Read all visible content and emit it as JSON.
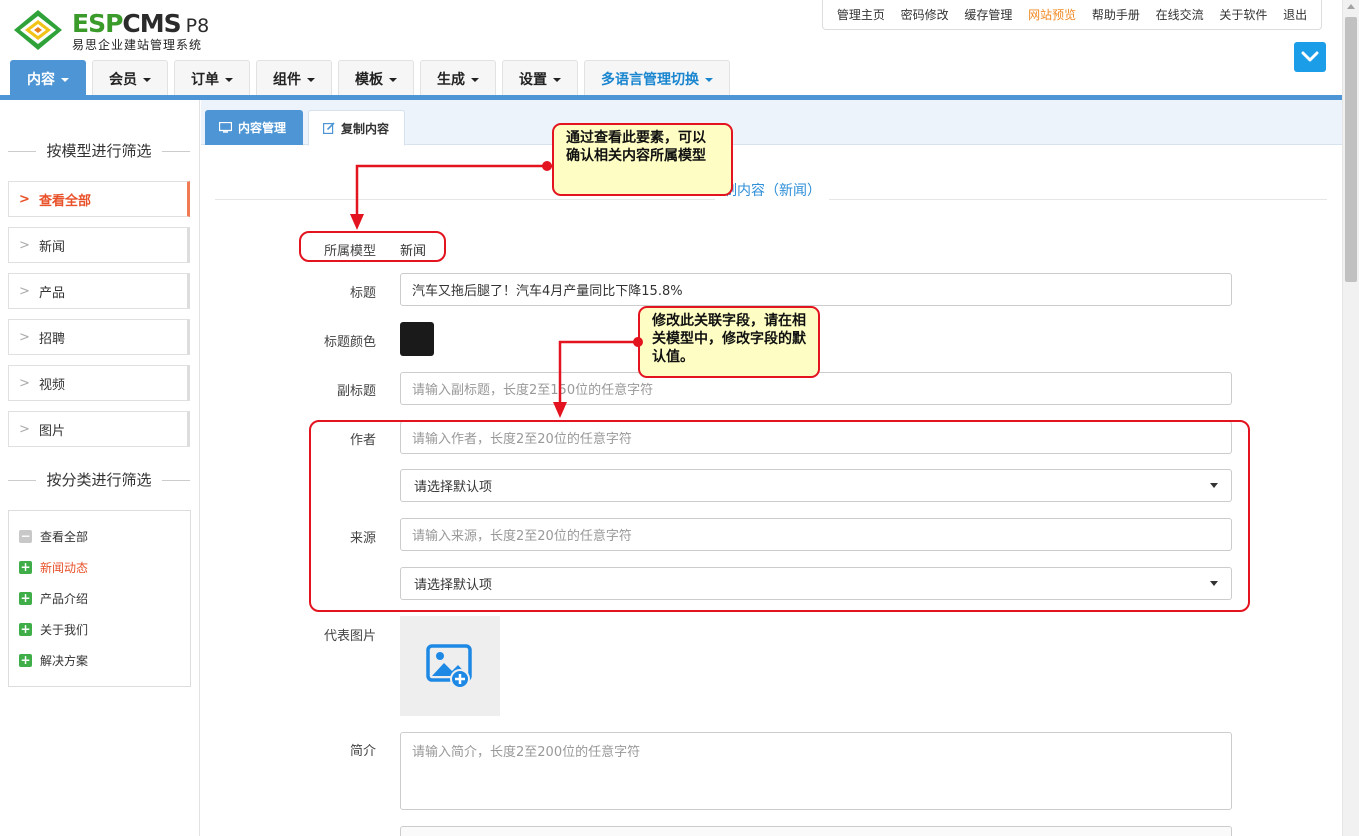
{
  "brand": {
    "esp": "ESP",
    "cms": "CMS",
    "version": "P8",
    "subtitle": "易思企业建站管理系统"
  },
  "topbar": {
    "links": [
      "管理主页",
      "密码修改",
      "缓存管理",
      "网站预览",
      "帮助手册",
      "在线交流",
      "关于软件",
      "退出"
    ],
    "highlight_color": "#f08a24"
  },
  "mainnav": {
    "items": [
      "内容",
      "会员",
      "订单",
      "组件",
      "模板",
      "生成",
      "设置",
      "多语言管理切换"
    ],
    "active_color": "#4d95d4"
  },
  "sidebar": {
    "model_filter_title": "按模型进行筛选",
    "models": [
      "查看全部",
      "新闻",
      "产品",
      "招聘",
      "视频",
      "图片"
    ],
    "category_filter_title": "按分类进行筛选",
    "categories": [
      "查看全部",
      "新闻动态",
      "产品介绍",
      "关于我们",
      "解决方案"
    ]
  },
  "tabs": {
    "content_manage": "内容管理",
    "copy_content": "复制内容"
  },
  "form": {
    "heading_fragment": "制内容（新闻）",
    "model_label": "所属模型",
    "model_value": "新闻",
    "title_label": "标题",
    "title_value": "汽车又拖后腿了！汽车4月产量同比下降15.8%",
    "title_color_label": "标题颜色",
    "title_color_value": "#1a1a1a",
    "subtitle_label": "副标题",
    "subtitle_placeholder": "请输入副标题，长度2至150位的任意字符",
    "author_label": "作者",
    "author_placeholder": "请输入作者，长度2至20位的任意字符",
    "author_select": "请选择默认项",
    "source_label": "来源",
    "source_placeholder": "请输入来源，长度2至20位的任意字符",
    "source_select": "请选择默认项",
    "image_label": "代表图片",
    "summary_label": "简介",
    "summary_placeholder": "请输入简介，长度2至200位的任意字符"
  },
  "annotations": {
    "callout_model": "通过查看此要素，可以确认相关内容所属模型",
    "callout_field": "修改此关联字段，请在相关模型中，修改字段的默认值。",
    "highlight_color": "#e3141f"
  }
}
